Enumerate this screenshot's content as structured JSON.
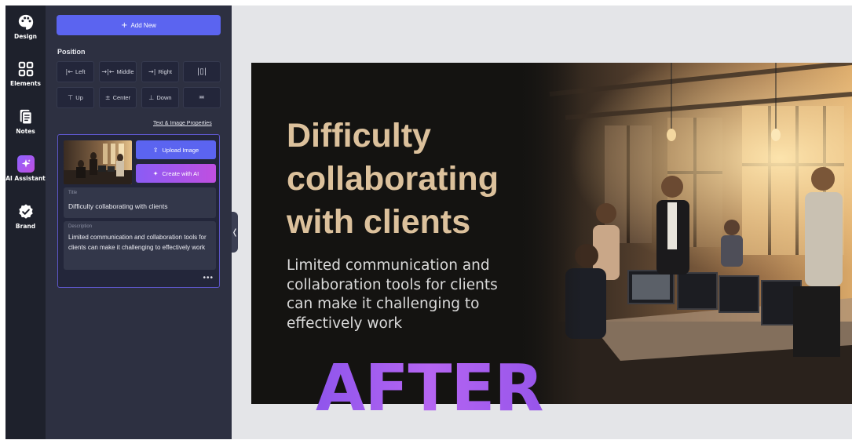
{
  "rail": {
    "items": [
      {
        "label": "Design",
        "icon": "palette-icon"
      },
      {
        "label": "Elements",
        "icon": "grid-icon"
      },
      {
        "label": "Notes",
        "icon": "notes-icon"
      },
      {
        "label": "AI Assistant",
        "icon": "sparkle-icon"
      },
      {
        "label": "Brand",
        "icon": "badge-check-icon"
      }
    ]
  },
  "panel": {
    "add_new": "Add New",
    "position_title": "Position",
    "position_buttons": {
      "left": "Left",
      "middle": "Middle",
      "right": "Right",
      "up": "Up",
      "center": "Center",
      "down": "Down"
    },
    "properties_link": "Text & Image Properties",
    "card": {
      "upload_label": "Upload Image",
      "create_label": "Create with AI",
      "title_label": "Title",
      "title_value": "Difficulty collaborating with clients",
      "description_label": "Description",
      "description_value": "Limited communication and collaboration tools for clients can make it challenging to effectively work",
      "more": "•••"
    },
    "collapse_glyph": "❬"
  },
  "slide": {
    "title": "Difficulty collaborating with clients",
    "description": "Limited communication and collaboration tools for clients can make it challenging to effectively work"
  },
  "overlay": {
    "text": "AFTER"
  },
  "colors": {
    "rail_bg": "#1e212c",
    "panel_bg": "#2d3041",
    "primary_button": "#5b64f0",
    "ai_gradient_start": "#8a5cf5",
    "ai_gradient_end": "#c04fe0",
    "slide_title": "#dcc19c",
    "after_text": "#b35ef0"
  }
}
